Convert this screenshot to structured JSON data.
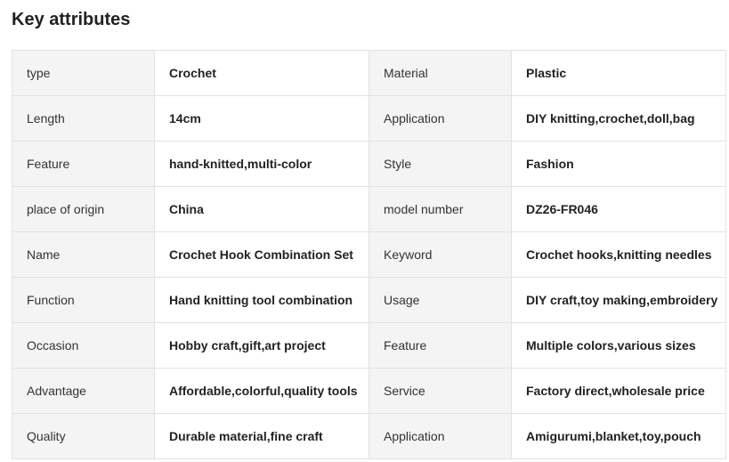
{
  "section": {
    "title": "Key attributes"
  },
  "rows": [
    {
      "k1": "type",
      "v1": "Crochet",
      "k2": "Material",
      "v2": "Plastic"
    },
    {
      "k1": "Length",
      "v1": "14cm",
      "k2": "Application",
      "v2": "DIY knitting,crochet,doll,bag"
    },
    {
      "k1": "Feature",
      "v1": "hand-knitted,multi-color",
      "k2": "Style",
      "v2": "Fashion"
    },
    {
      "k1": "place of origin",
      "v1": "China",
      "k2": "model number",
      "v2": "DZ26-FR046"
    },
    {
      "k1": "Name",
      "v1": "Crochet Hook Combination Set",
      "k2": "Keyword",
      "v2": "Crochet hooks,knitting needles"
    },
    {
      "k1": "Function",
      "v1": "Hand knitting tool combination",
      "k2": "Usage",
      "v2": "DIY craft,toy making,embroidery"
    },
    {
      "k1": "Occasion",
      "v1": "Hobby craft,gift,art project",
      "k2": "Feature",
      "v2": "Multiple colors,various sizes"
    },
    {
      "k1": "Advantage",
      "v1": "Affordable,colorful,quality tools",
      "k2": "Service",
      "v2": "Factory direct,wholesale price"
    },
    {
      "k1": "Quality",
      "v1": "Durable material,fine craft",
      "k2": "Application",
      "v2": "Amigurumi,blanket,toy,pouch"
    }
  ],
  "colors": {
    "key_background": "#f4f4f4",
    "value_background": "#ffffff",
    "border": "#e2e2e2",
    "text": "#222222"
  }
}
